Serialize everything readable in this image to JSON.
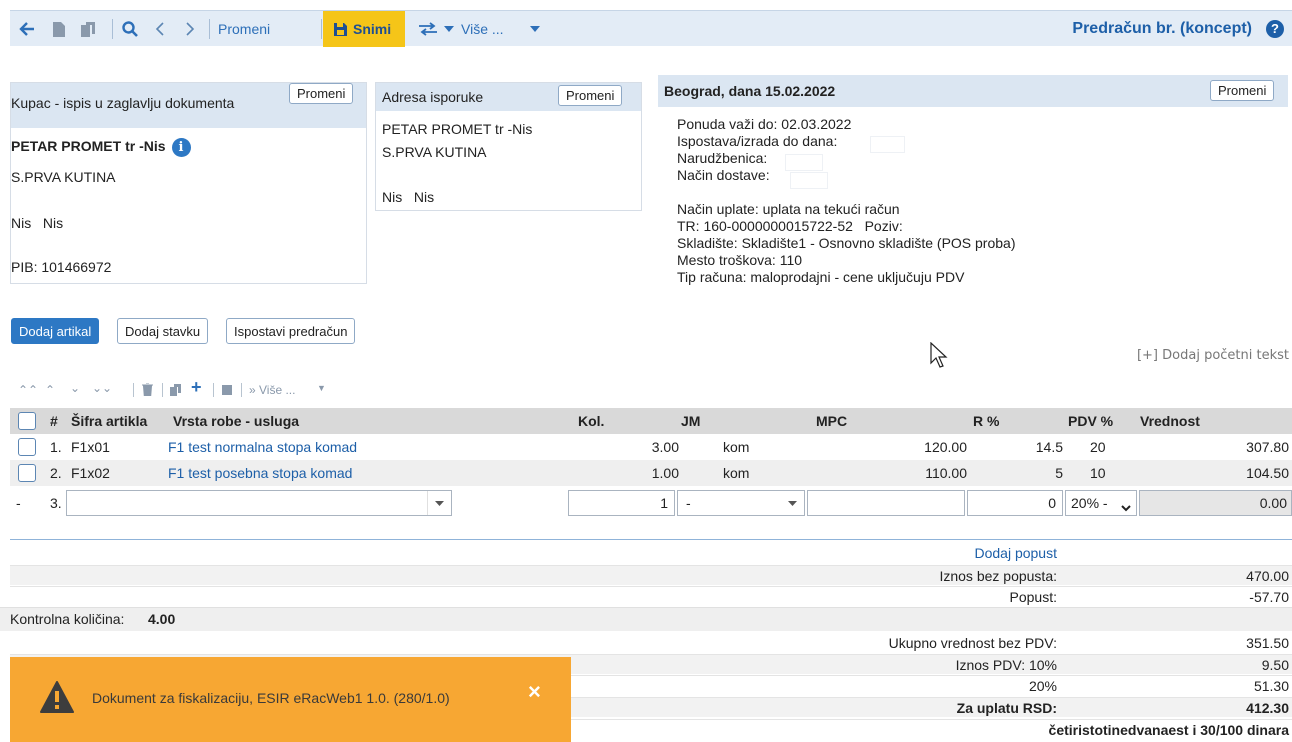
{
  "toolbar": {
    "edit_label": "Promeni",
    "save_label": "Snimi",
    "more_label": "Više ...",
    "title": "Predračun br. (koncept)"
  },
  "customer": {
    "header": "Kupac - ispis u zaglavlju dokumenta",
    "button": "Promeni",
    "name": "PETAR PROMET tr -Nis",
    "street": "S.PRVA KUTINA",
    "city1": "Nis",
    "city2": "Nis",
    "pib": "PIB: 101466972"
  },
  "delivery": {
    "header": "Adresa isporuke",
    "button": "Promeni",
    "name": "PETAR PROMET tr -Nis",
    "street": "S.PRVA KUTINA",
    "city1": "Nis",
    "city2": "Nis"
  },
  "doc_info": {
    "header": "Beograd, dana 15.02.2022",
    "button": "Promeni",
    "valid_until": "Ponuda važi do: 02.03.2022",
    "delivery_date": "Ispostava/izrada do dana:",
    "order": "Narudžbenica:",
    "shipping": "Način dostave:",
    "payment": "Način uplate: uplata na tekući račun",
    "account": "TR: 160-0000000015722-52   Poziv:",
    "warehouse": "Skladište: Skladište1 - Osnovno skladište (POS proba)",
    "cost_center": "Mesto troškova: 110",
    "invoice_type": "Tip računa: maloprodajni - cene uključuju PDV"
  },
  "actions": {
    "add_article": "Dodaj artikal",
    "add_item": "Dodaj stavku",
    "issue_invoice": "Ispostavi predračun",
    "add_intro": "[+] Dodaj početni tekst"
  },
  "grid_toolbar": {
    "more_label": "» Više ..."
  },
  "table": {
    "headers": {
      "num": "#",
      "code": "Šifra artikla",
      "desc": "Vrsta robe - usluga",
      "qty": "Kol.",
      "unit": "JM",
      "price": "MPC",
      "discount": "R %",
      "vat": "PDV %",
      "value": "Vrednost"
    },
    "rows": [
      {
        "num": "1.",
        "code": "F1x01",
        "desc": "F1 test normalna stopa komad",
        "qty": "3.00",
        "unit": "kom",
        "price": "120.00",
        "discount": "14.5",
        "vat": "20",
        "value": "307.80"
      },
      {
        "num": "2.",
        "code": "F1x02",
        "desc": "F1 test posebna stopa komad",
        "qty": "1.00",
        "unit": "kom",
        "price": "110.00",
        "discount": "5",
        "vat": "10",
        "value": "104.50"
      }
    ],
    "new_row": {
      "dash": "-",
      "num": "3.",
      "qty": "1",
      "unit": "-",
      "discount": "0",
      "vat": "20% -",
      "value": "0.00"
    }
  },
  "summary": {
    "add_discount": "Dodaj popust",
    "gross_label": "Iznos bez popusta:",
    "gross_value": "470.00",
    "discount_label": "Popust:",
    "discount_value": "-57.70",
    "control_label": "Kontrolna količina:",
    "control_value": "4.00",
    "net_label": "Ukupno vrednost bez PDV:",
    "net_value": "351.50",
    "vat10_label": "Iznos PDV: 10%",
    "vat10_value": "9.50",
    "vat20_label": "20%",
    "vat20_value": "51.30",
    "total_label": "Za uplatu RSD:",
    "total_value": "412.30",
    "in_words": "četiristotinedvanaest i 30/100 dinara"
  },
  "toast": {
    "message": "Dokument za fiskalizaciju, ESIR eRacWeb1 1.0. (280/1.0)",
    "close": "×"
  },
  "colors": {
    "toolbar_bg": "#e3ecf6",
    "accent": "#2d78c4",
    "save_bg": "#f5c518",
    "panel_header_bg": "#dbe6f2",
    "toast_bg": "#f7a733"
  }
}
